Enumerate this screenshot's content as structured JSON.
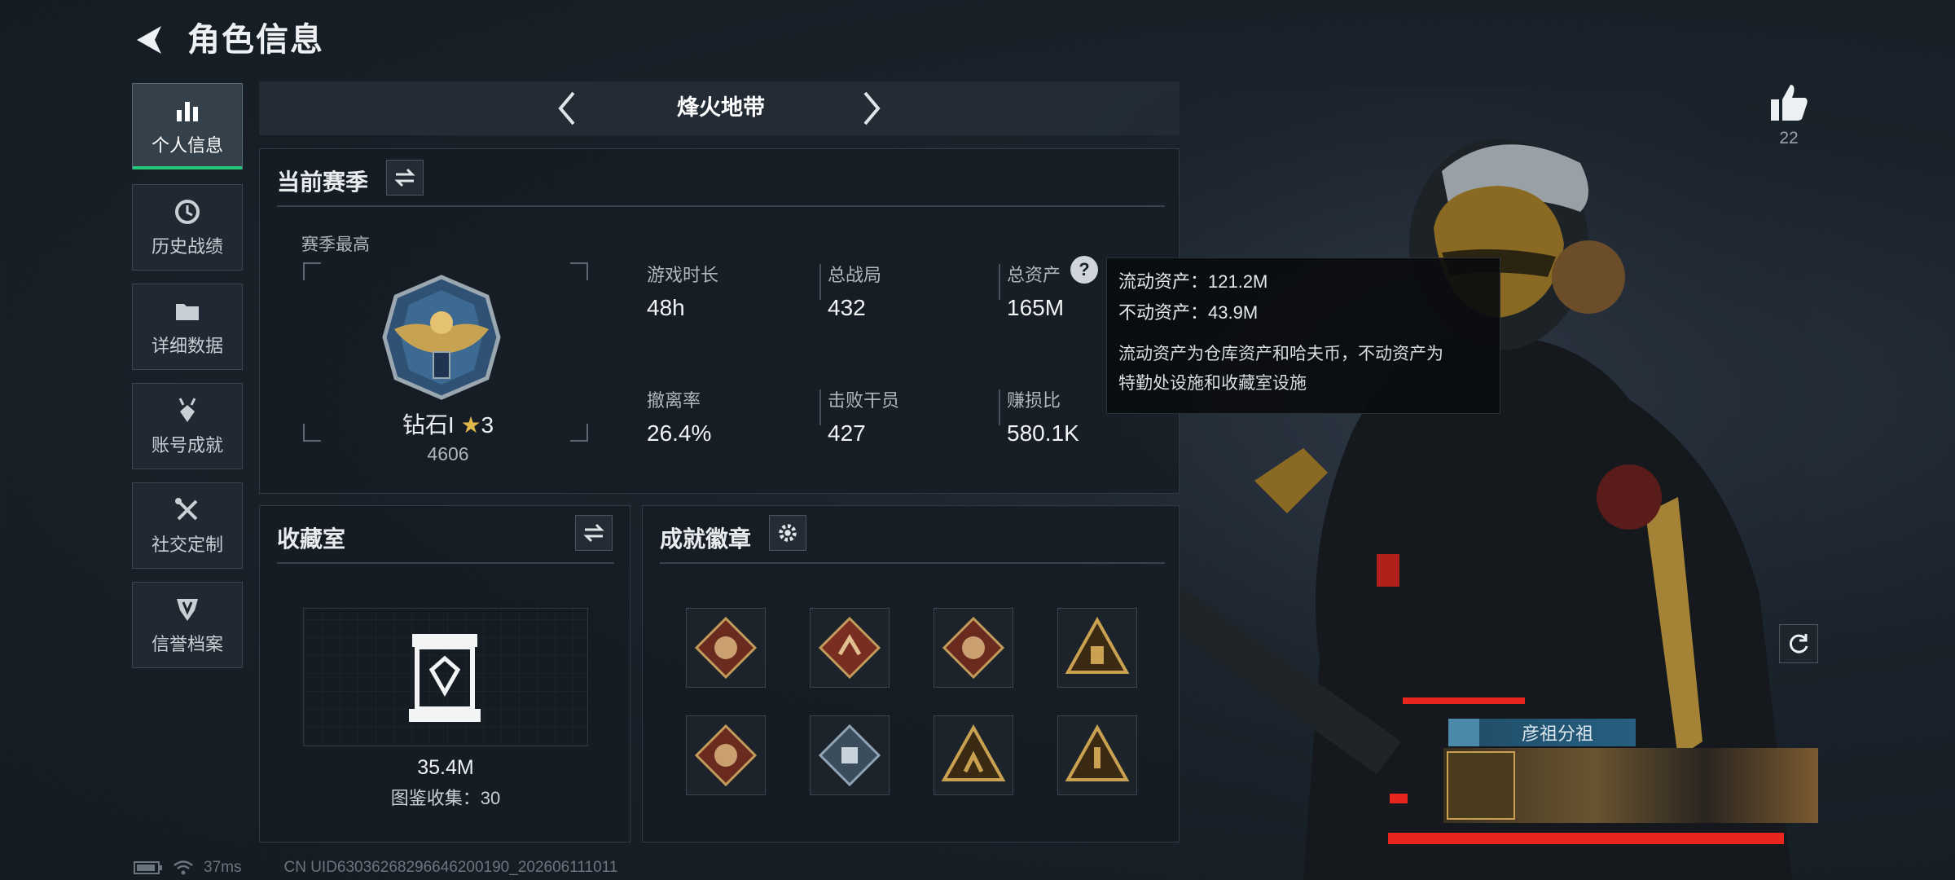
{
  "header": {
    "title": "角色信息",
    "back_icon": "back-arrow-icon"
  },
  "sidebar": {
    "items": [
      {
        "label": "个人信息",
        "icon": "bar-chart-icon",
        "active": true
      },
      {
        "label": "历史战绩",
        "icon": "clock-icon",
        "active": false
      },
      {
        "label": "详细数据",
        "icon": "folder-icon",
        "active": false
      },
      {
        "label": "账号成就",
        "icon": "medal-icon",
        "active": false
      },
      {
        "label": "社交定制",
        "icon": "tools-icon",
        "active": false
      },
      {
        "label": "信誉档案",
        "icon": "shield-icon",
        "active": false
      }
    ],
    "active_color": "#25c77b"
  },
  "mode_tab": {
    "title": "烽火地带"
  },
  "season": {
    "title": "当前赛季",
    "highest_label": "赛季最高",
    "rank_name": "钻石I",
    "rank_stars": "3",
    "rank_points": "4606",
    "stats": [
      {
        "label": "游戏时长",
        "value": "48h"
      },
      {
        "label": "总战局",
        "value": "432"
      },
      {
        "label": "总资产",
        "value": "165M"
      },
      {
        "label": "撤离率",
        "value": "26.4%"
      },
      {
        "label": "击败干员",
        "value": "427"
      },
      {
        "label": "赚损比",
        "value": "580.1K"
      }
    ]
  },
  "tooltip": {
    "line1": "流动资产：121.2M",
    "line2": "不动资产：43.9M",
    "desc1": "流动资产为仓库资产和哈夫币，不动资产为",
    "desc2": "特勤处设施和收藏室设施"
  },
  "collection": {
    "title": "收藏室",
    "value": "35.4M",
    "count_label": "图鉴收集：30"
  },
  "achievements": {
    "title": "成就徽章",
    "badge_count": 8
  },
  "likes": {
    "count": "22"
  },
  "team": {
    "name": "彦祖分祖"
  },
  "status": {
    "ping": "37ms",
    "uid": "CN UID630362682966462001​90_202606111011"
  }
}
